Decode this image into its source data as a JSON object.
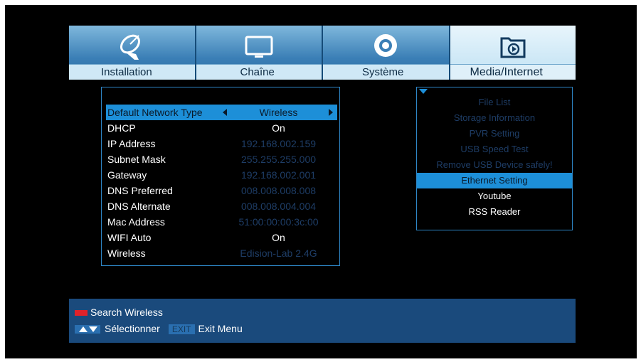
{
  "tabs": [
    {
      "label": "Installation",
      "icon": "satellite-dish-icon",
      "active": false
    },
    {
      "label": "Chaîne",
      "icon": "tv-icon",
      "active": false
    },
    {
      "label": "Système",
      "icon": "gear-icon",
      "active": false
    },
    {
      "label": "Media/Internet",
      "icon": "media-folder-icon",
      "active": true
    }
  ],
  "settings": [
    {
      "name": "Default Network Type",
      "value": "Wireless"
    },
    {
      "name": "DHCP",
      "value": "On"
    },
    {
      "name": "IP Address",
      "value": "192.168.002.159"
    },
    {
      "name": "Subnet Mask",
      "value": "255.255.255.000"
    },
    {
      "name": "Gateway",
      "value": "192.168.002.001"
    },
    {
      "name": "DNS Preferred",
      "value": "008.008.008.008"
    },
    {
      "name": "DNS Alternate",
      "value": "008.008.004.004"
    },
    {
      "name": "Mac Address",
      "value": "51:00:00:00:3c:00"
    },
    {
      "name": "WIFI Auto",
      "value": "On"
    },
    {
      "name": "Wireless",
      "value": "Edision-Lab 2.4G"
    }
  ],
  "submenu": [
    {
      "label": "File List"
    },
    {
      "label": "Storage Information"
    },
    {
      "label": "PVR Setting"
    },
    {
      "label": "USB Speed Test"
    },
    {
      "label": "Remove USB Device safely!"
    },
    {
      "label": "Ethernet Setting"
    },
    {
      "label": "Youtube"
    },
    {
      "label": "RSS Reader"
    }
  ],
  "help": {
    "red_label": "Search Wireless",
    "select_label": "Sélectionner",
    "exit_key": "EXIT",
    "exit_label": "Exit Menu"
  },
  "colors": {
    "accent": "#1d8fd8",
    "bar": "#1a4a7c",
    "red": "#e0222a"
  }
}
